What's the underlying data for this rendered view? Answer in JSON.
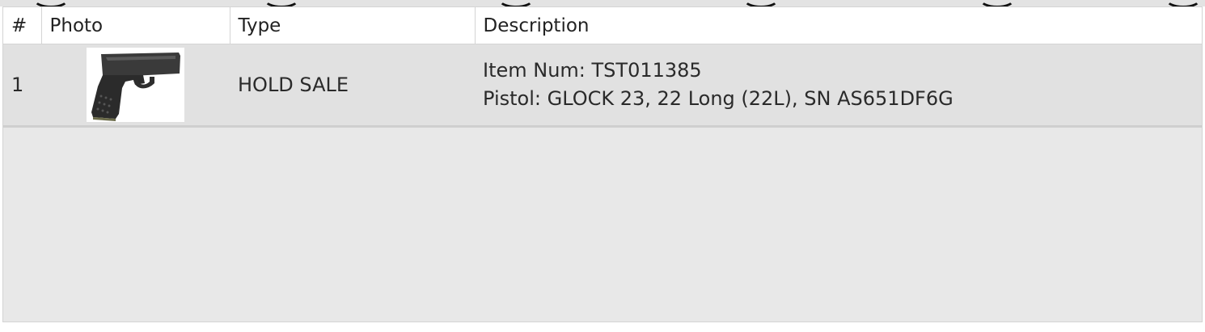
{
  "table": {
    "columns": {
      "num": "#",
      "photo": "Photo",
      "type": "Type",
      "description": "Description"
    },
    "rows": [
      {
        "num": "1",
        "photo_icon": "pistol-photo",
        "type": "HOLD SALE",
        "item_num": "Item Num: TST011385",
        "detail": "Pistol: GLOCK 23, 22 Long (22L), SN AS651DF6G"
      }
    ]
  }
}
